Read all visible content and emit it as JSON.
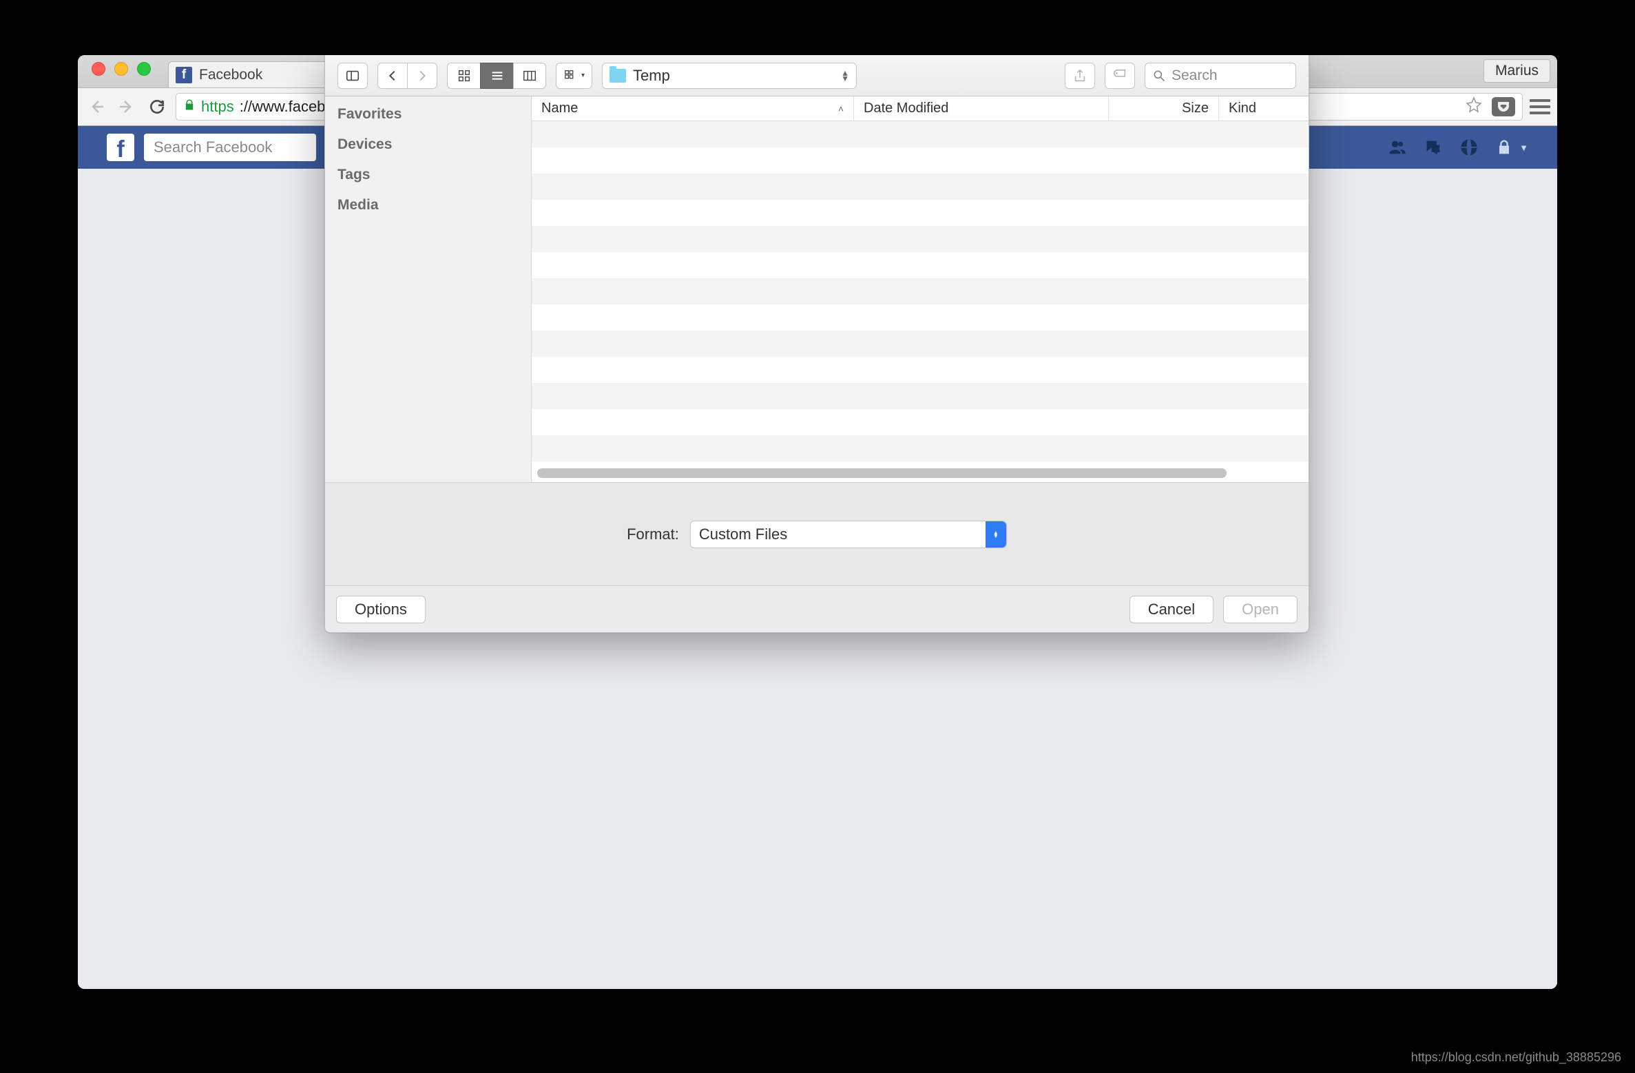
{
  "browser": {
    "tab_title": "Facebook",
    "user_label": "Marius",
    "url_scheme": "https",
    "url_rest": "://www.facebook.com"
  },
  "facebook": {
    "search_placeholder": "Search Facebook"
  },
  "dialog": {
    "path_label": "Temp",
    "search_placeholder": "Search",
    "sidebar": {
      "favorites": "Favorites",
      "devices": "Devices",
      "tags": "Tags",
      "media": "Media"
    },
    "columns": {
      "name": "Name",
      "date": "Date Modified",
      "size": "Size",
      "kind": "Kind"
    },
    "format_label": "Format:",
    "format_value": "Custom Files",
    "buttons": {
      "options": "Options",
      "cancel": "Cancel",
      "open": "Open"
    }
  },
  "watermark": "https://blog.csdn.net/github_38885296"
}
